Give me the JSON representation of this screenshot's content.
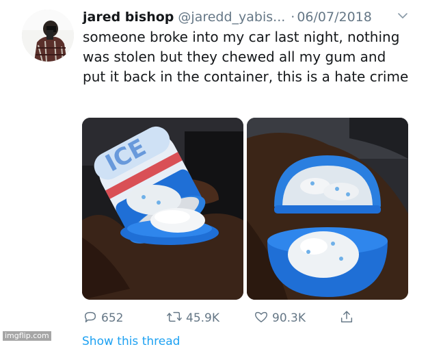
{
  "tweet": {
    "author_name": "jared bishop",
    "handle": "@jaredd_yabis...",
    "dot": "·",
    "date": "06/07/2018",
    "text": "someone broke into my car last night, nothing was stolen but they chewed all my gum and put it back in the container, this is a hate crime"
  },
  "actions": {
    "replies": "652",
    "retweets": "45.9K",
    "likes": "90.3K"
  },
  "thread_link": "Show this thread",
  "watermark": "imgflip.com",
  "colors": {
    "text": "#14171a",
    "secondary": "#657786",
    "link": "#1da1f2",
    "gum_container_blue": "#1f6fd6"
  },
  "icons": [
    "chevron-down-icon",
    "reply-icon",
    "retweet-icon",
    "like-icon",
    "share-icon"
  ]
}
